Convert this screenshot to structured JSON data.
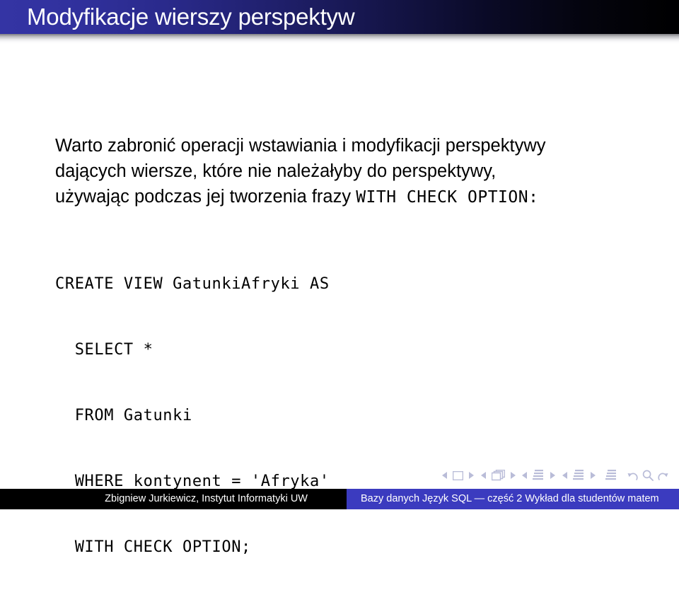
{
  "slide": {
    "title": "Modyfikacje wierszy perspektyw",
    "colors": {
      "title_gradient_start": "#3434a4",
      "title_gradient_end": "#000000",
      "footer_left_bg": "#000000",
      "footer_right_bg": "#3b3bbf",
      "nav_icon": "#b9bcd8",
      "background": "#ffffff",
      "text": "#000000"
    }
  },
  "body": {
    "paragraph_lines": [
      "Warto zabronić operacji wstawiania i modyfikacji perspektywy",
      "dających wiersze, które nie należałyby do perspektywy,",
      "używając podczas jej tworzenia frazy "
    ],
    "inline_code": "WITH CHECK OPTION",
    "inline_code_suffix": ":"
  },
  "code_block": {
    "language": "sql",
    "lines": [
      "CREATE VIEW GatunkiAfryki AS",
      "  SELECT *",
      "  FROM Gatunki",
      "  WHERE kontynent = 'Afryka'",
      "  WITH CHECK OPTION;"
    ]
  },
  "navigation": {
    "items": [
      {
        "name": "prev-slide",
        "icon": "triangle-left-icon"
      },
      {
        "name": "current-slide",
        "icon": "square-icon"
      },
      {
        "name": "next-slide",
        "icon": "triangle-right-icon"
      },
      {
        "name": "prev-frame",
        "icon": "triangle-left-icon"
      },
      {
        "name": "current-frame",
        "icon": "frames-stack-icon"
      },
      {
        "name": "next-frame",
        "icon": "triangle-right-icon"
      },
      {
        "name": "prev-subsection",
        "icon": "triangle-left-icon"
      },
      {
        "name": "current-subsection",
        "icon": "lines-stack-icon"
      },
      {
        "name": "next-subsection",
        "icon": "triangle-right-icon"
      },
      {
        "name": "prev-section",
        "icon": "triangle-left-icon"
      },
      {
        "name": "current-section",
        "icon": "lines-stack-icon"
      },
      {
        "name": "next-section",
        "icon": "triangle-right-icon"
      },
      {
        "name": "presentation-overview",
        "icon": "lines-stack-icon"
      },
      {
        "name": "go-back",
        "icon": "undo-arrow-icon"
      },
      {
        "name": "search",
        "icon": "magnifier-icon"
      },
      {
        "name": "go-forward",
        "icon": "redo-arrow-icon"
      }
    ]
  },
  "footer": {
    "author": "Zbigniew Jurkiewicz, Instytut Informatyki UW",
    "talk_title": "Bazy danych Język SQL — część 2 Wykład dla studentów matem"
  }
}
